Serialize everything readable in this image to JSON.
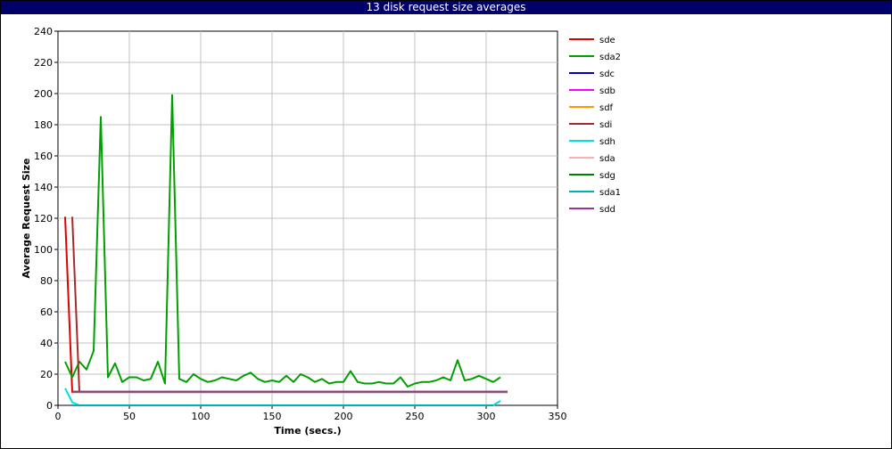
{
  "chart_data": {
    "type": "line",
    "title": "13 disk request size averages",
    "xlabel": "Time (secs.)",
    "ylabel": "Average Request Size",
    "xlim": [
      0,
      350
    ],
    "ylim": [
      0,
      240
    ],
    "xticks": [
      0,
      50,
      100,
      150,
      200,
      250,
      300,
      350
    ],
    "yticks": [
      0,
      20,
      40,
      60,
      80,
      100,
      120,
      140,
      160,
      180,
      200,
      220,
      240
    ],
    "grid": true,
    "legend_position": "right",
    "series": [
      {
        "name": "sde",
        "color": "#e00000",
        "points": [
          [
            5,
            121
          ],
          [
            10,
            8.5
          ],
          [
            315,
            8.5
          ]
        ]
      },
      {
        "name": "sda2",
        "color": "#00a000",
        "points": [
          [
            5,
            28
          ],
          [
            10,
            18
          ],
          [
            15,
            28
          ],
          [
            20,
            23
          ],
          [
            25,
            35
          ],
          [
            30,
            185
          ],
          [
            35,
            18
          ],
          [
            40,
            27
          ],
          [
            45,
            15
          ],
          [
            50,
            18
          ],
          [
            55,
            18
          ],
          [
            60,
            16
          ],
          [
            65,
            17
          ],
          [
            70,
            28
          ],
          [
            75,
            14
          ],
          [
            80,
            199
          ],
          [
            85,
            17
          ],
          [
            90,
            15
          ],
          [
            95,
            20
          ],
          [
            100,
            17
          ],
          [
            105,
            15
          ],
          [
            110,
            16
          ],
          [
            115,
            18
          ],
          [
            120,
            17
          ],
          [
            125,
            16
          ],
          [
            130,
            19
          ],
          [
            135,
            21
          ],
          [
            140,
            17
          ],
          [
            145,
            15
          ],
          [
            150,
            16
          ],
          [
            155,
            15
          ],
          [
            160,
            19
          ],
          [
            165,
            15
          ],
          [
            170,
            20
          ],
          [
            175,
            18
          ],
          [
            180,
            15
          ],
          [
            185,
            17
          ],
          [
            190,
            14
          ],
          [
            195,
            15
          ],
          [
            200,
            15
          ],
          [
            205,
            22
          ],
          [
            210,
            15
          ],
          [
            215,
            14
          ],
          [
            220,
            14
          ],
          [
            225,
            15
          ],
          [
            230,
            14
          ],
          [
            235,
            14
          ],
          [
            240,
            18
          ],
          [
            245,
            12
          ],
          [
            250,
            14
          ],
          [
            255,
            15
          ],
          [
            260,
            15
          ],
          [
            265,
            16
          ],
          [
            270,
            18
          ],
          [
            275,
            16
          ],
          [
            280,
            29
          ],
          [
            285,
            16
          ],
          [
            290,
            17
          ],
          [
            295,
            19
          ],
          [
            300,
            17
          ],
          [
            305,
            15
          ],
          [
            310,
            18
          ]
        ]
      },
      {
        "name": "sdc",
        "color": "#0000c0",
        "points": [
          [
            10,
            8.3
          ],
          [
            315,
            8.3
          ]
        ]
      },
      {
        "name": "sdb",
        "color": "#ff00ff",
        "points": [
          [
            10,
            8.4
          ],
          [
            315,
            8.4
          ]
        ]
      },
      {
        "name": "sdf",
        "color": "#ff9900",
        "points": [
          [
            10,
            8.6
          ],
          [
            315,
            8.6
          ]
        ]
      },
      {
        "name": "sdi",
        "color": "#a52a2a",
        "points": [
          [
            10,
            121
          ],
          [
            15,
            8.5
          ],
          [
            315,
            8.5
          ]
        ]
      },
      {
        "name": "sdh",
        "color": "#00e0e0",
        "points": [
          [
            5,
            11
          ],
          [
            10,
            2
          ],
          [
            15,
            0
          ],
          [
            305,
            0
          ],
          [
            310,
            3
          ]
        ]
      },
      {
        "name": "sda",
        "color": "#ffb0b0",
        "points": [
          [
            10,
            8.2
          ],
          [
            315,
            8.2
          ]
        ]
      },
      {
        "name": "sdg",
        "color": "#008000",
        "points": [
          [
            10,
            8.7
          ],
          [
            315,
            8.7
          ]
        ]
      },
      {
        "name": "sda1",
        "color": "#00b0b0",
        "points": [
          [
            10,
            0
          ],
          [
            305,
            0
          ]
        ]
      },
      {
        "name": "sdd",
        "color": "#993399",
        "points": [
          [
            10,
            8.8
          ],
          [
            315,
            8.8
          ]
        ]
      }
    ]
  }
}
